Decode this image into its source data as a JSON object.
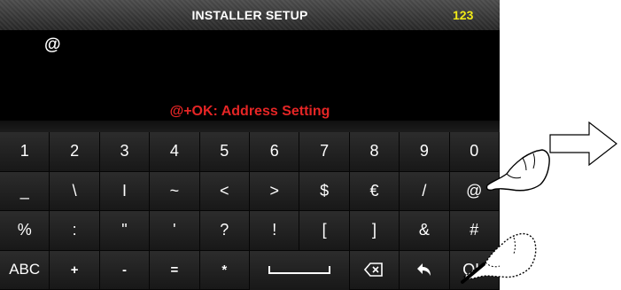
{
  "title_bar": {
    "title": "INSTALLER SETUP",
    "mode_indicator": "123"
  },
  "entry": {
    "value": "@"
  },
  "hint": {
    "text": "@+OK: Address Setting"
  },
  "keyboard": {
    "row1": [
      "1",
      "2",
      "3",
      "4",
      "5",
      "6",
      "7",
      "8",
      "9",
      "0"
    ],
    "row2": [
      "_",
      "\\",
      "I",
      "~",
      "<",
      ">",
      "$",
      "€",
      "/",
      "@"
    ],
    "row3": [
      "%",
      ":",
      "\"",
      "'",
      "?",
      "!",
      "[",
      "]",
      "&",
      "#"
    ],
    "row4": {
      "abc": "ABC",
      "plus": "+",
      "minus": "-",
      "equals": "=",
      "star": "*",
      "ok": "OK"
    }
  },
  "colors": {
    "title": "#ffffff",
    "mode_indicator": "#f1ea18",
    "hint": "#e52525",
    "screen_bg": "#000000"
  },
  "icons": {
    "space": "space-bar-icon",
    "backspace": "backspace-icon",
    "back": "back-arrow-icon",
    "annotation_arrow": "arrow-right-icon",
    "hand": "pointing-hand-icon"
  }
}
